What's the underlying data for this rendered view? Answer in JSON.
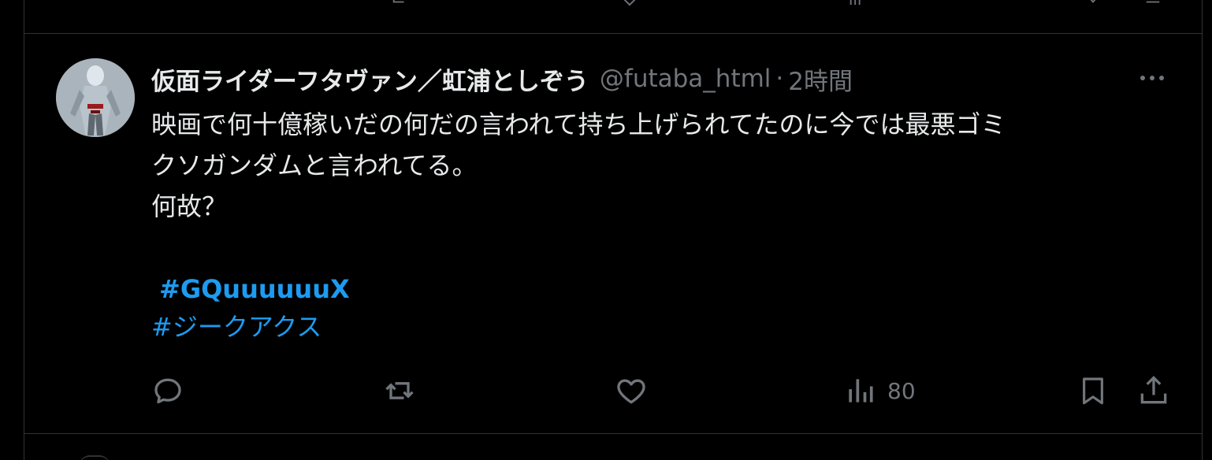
{
  "tweet": {
    "display_name": "仮面ライダーフタヴァン／虹浦としぞう",
    "handle": "@futaba_html",
    "separator": "·",
    "time": "2時間",
    "text_lines": [
      "映画で何十億稼いだの何だの言われて持ち上げられてたのに今では最悪ゴミ",
      "クソガンダムと言われてる。",
      "何故？"
    ],
    "hashtags": [
      "#GQuuuuuuX",
      "#ジークアクス"
    ],
    "views": "80"
  },
  "icons": {
    "avatar": "avatar",
    "more": "more-horizontal-icon",
    "reply": "reply-icon",
    "retweet": "retweet-icon",
    "like": "heart-icon",
    "views": "views-icon",
    "bookmark": "bookmark-icon",
    "share": "share-icon"
  },
  "colors": {
    "background": "#000000",
    "text": "#e7e9ea",
    "secondary": "#71767b",
    "accent": "#1d9bf0",
    "border": "#2f3336"
  }
}
